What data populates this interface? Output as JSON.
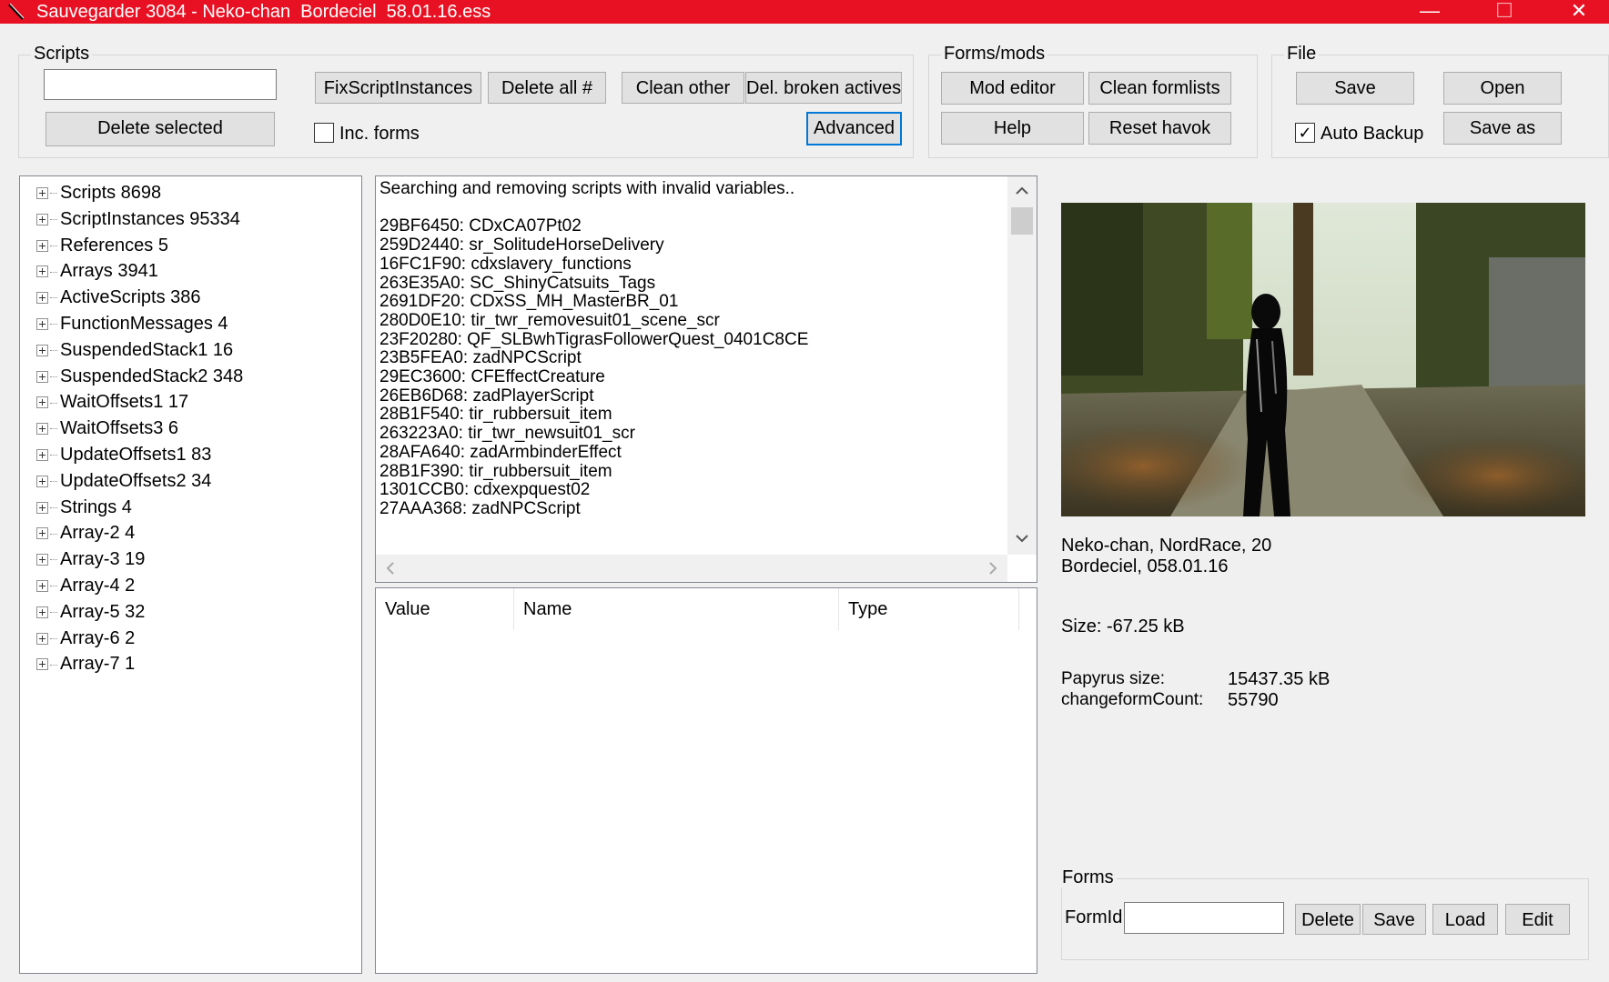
{
  "window": {
    "title": "Sauvegarder 3084 - Neko-chan  Bordeciel  58.01.16.ess",
    "minimize_glyph": "—",
    "maximize_glyph": "☐",
    "close_glyph": "✕"
  },
  "scripts_group": {
    "label": "Scripts",
    "search_value": "",
    "delete_selected": "Delete selected",
    "fix_script_instances": "FixScriptInstances",
    "delete_all": "Delete all #",
    "clean_other": "Clean other",
    "del_broken_actives": "Del. broken actives",
    "advanced": "Advanced",
    "inc_forms_label": "Inc. forms",
    "inc_forms_checked": false
  },
  "forms_mods_group": {
    "label": "Forms/mods",
    "mod_editor": "Mod editor",
    "clean_formlists": "Clean formlists",
    "help": "Help",
    "reset_havok": "Reset havok"
  },
  "file_group": {
    "label": "File",
    "save": "Save",
    "open": "Open",
    "save_as": "Save as",
    "auto_backup_label": "Auto Backup",
    "auto_backup_checked": true,
    "check_glyph": "✓"
  },
  "tree": {
    "items": [
      "Scripts 8698",
      "ScriptInstances 95334",
      "References 5",
      "Arrays 3941",
      "ActiveScripts 386",
      "FunctionMessages 4",
      "SuspendedStack1 16",
      "SuspendedStack2 348",
      "WaitOffsets1 17",
      "WaitOffsets3 6",
      "UpdateOffsets1 83",
      "UpdateOffsets2 34",
      "Strings 4",
      "Array-2 4",
      "Array-3 19",
      "Array-4 2",
      "Array-5 32",
      "Array-6 2",
      "Array-7 1"
    ]
  },
  "log": {
    "text": "Searching and removing scripts with invalid variables..\n\n29BF6450: CDxCA07Pt02\n259D2440: sr_SolitudeHorseDelivery\n16FC1F90: cdxslavery_functions\n263E35A0: SC_ShinyCatsuits_Tags\n2691DF20: CDxSS_MH_MasterBR_01\n280D0E10: tir_twr_removesuit01_scene_scr\n23F20280: QF_SLBwhTigrasFollowerQuest_0401C8CE\n23B5FEA0: zadNPCScript\n29EC3600: CFEffectCreature\n26EB6D68: zadPlayerScript\n28B1F540: tir_rubbersuit_item\n263223A0: tir_twr_newsuit01_scr\n28AFA640: zadArmbinderEffect\n28B1F390: tir_rubbersuit_item\n1301CCB0: cdxexpquest02\n27AAA368: zadNPCScript"
  },
  "table": {
    "columns": [
      "Value",
      "Name",
      "Type"
    ]
  },
  "info": {
    "line1": "Neko-chan, NordRace, 20",
    "line2": "Bordeciel, 058.01.16",
    "size": "Size: -67.25 kB",
    "papyrus_label": "Papyrus size:",
    "papyrus_value": "15437.35 kB",
    "changeform_label": "changeformCount:",
    "changeform_value": "55790"
  },
  "forms_group": {
    "label": "Forms",
    "formid_label": "FormId",
    "formid_value": "",
    "delete": "Delete",
    "save": "Save",
    "load": "Load",
    "edit": "Edit"
  }
}
